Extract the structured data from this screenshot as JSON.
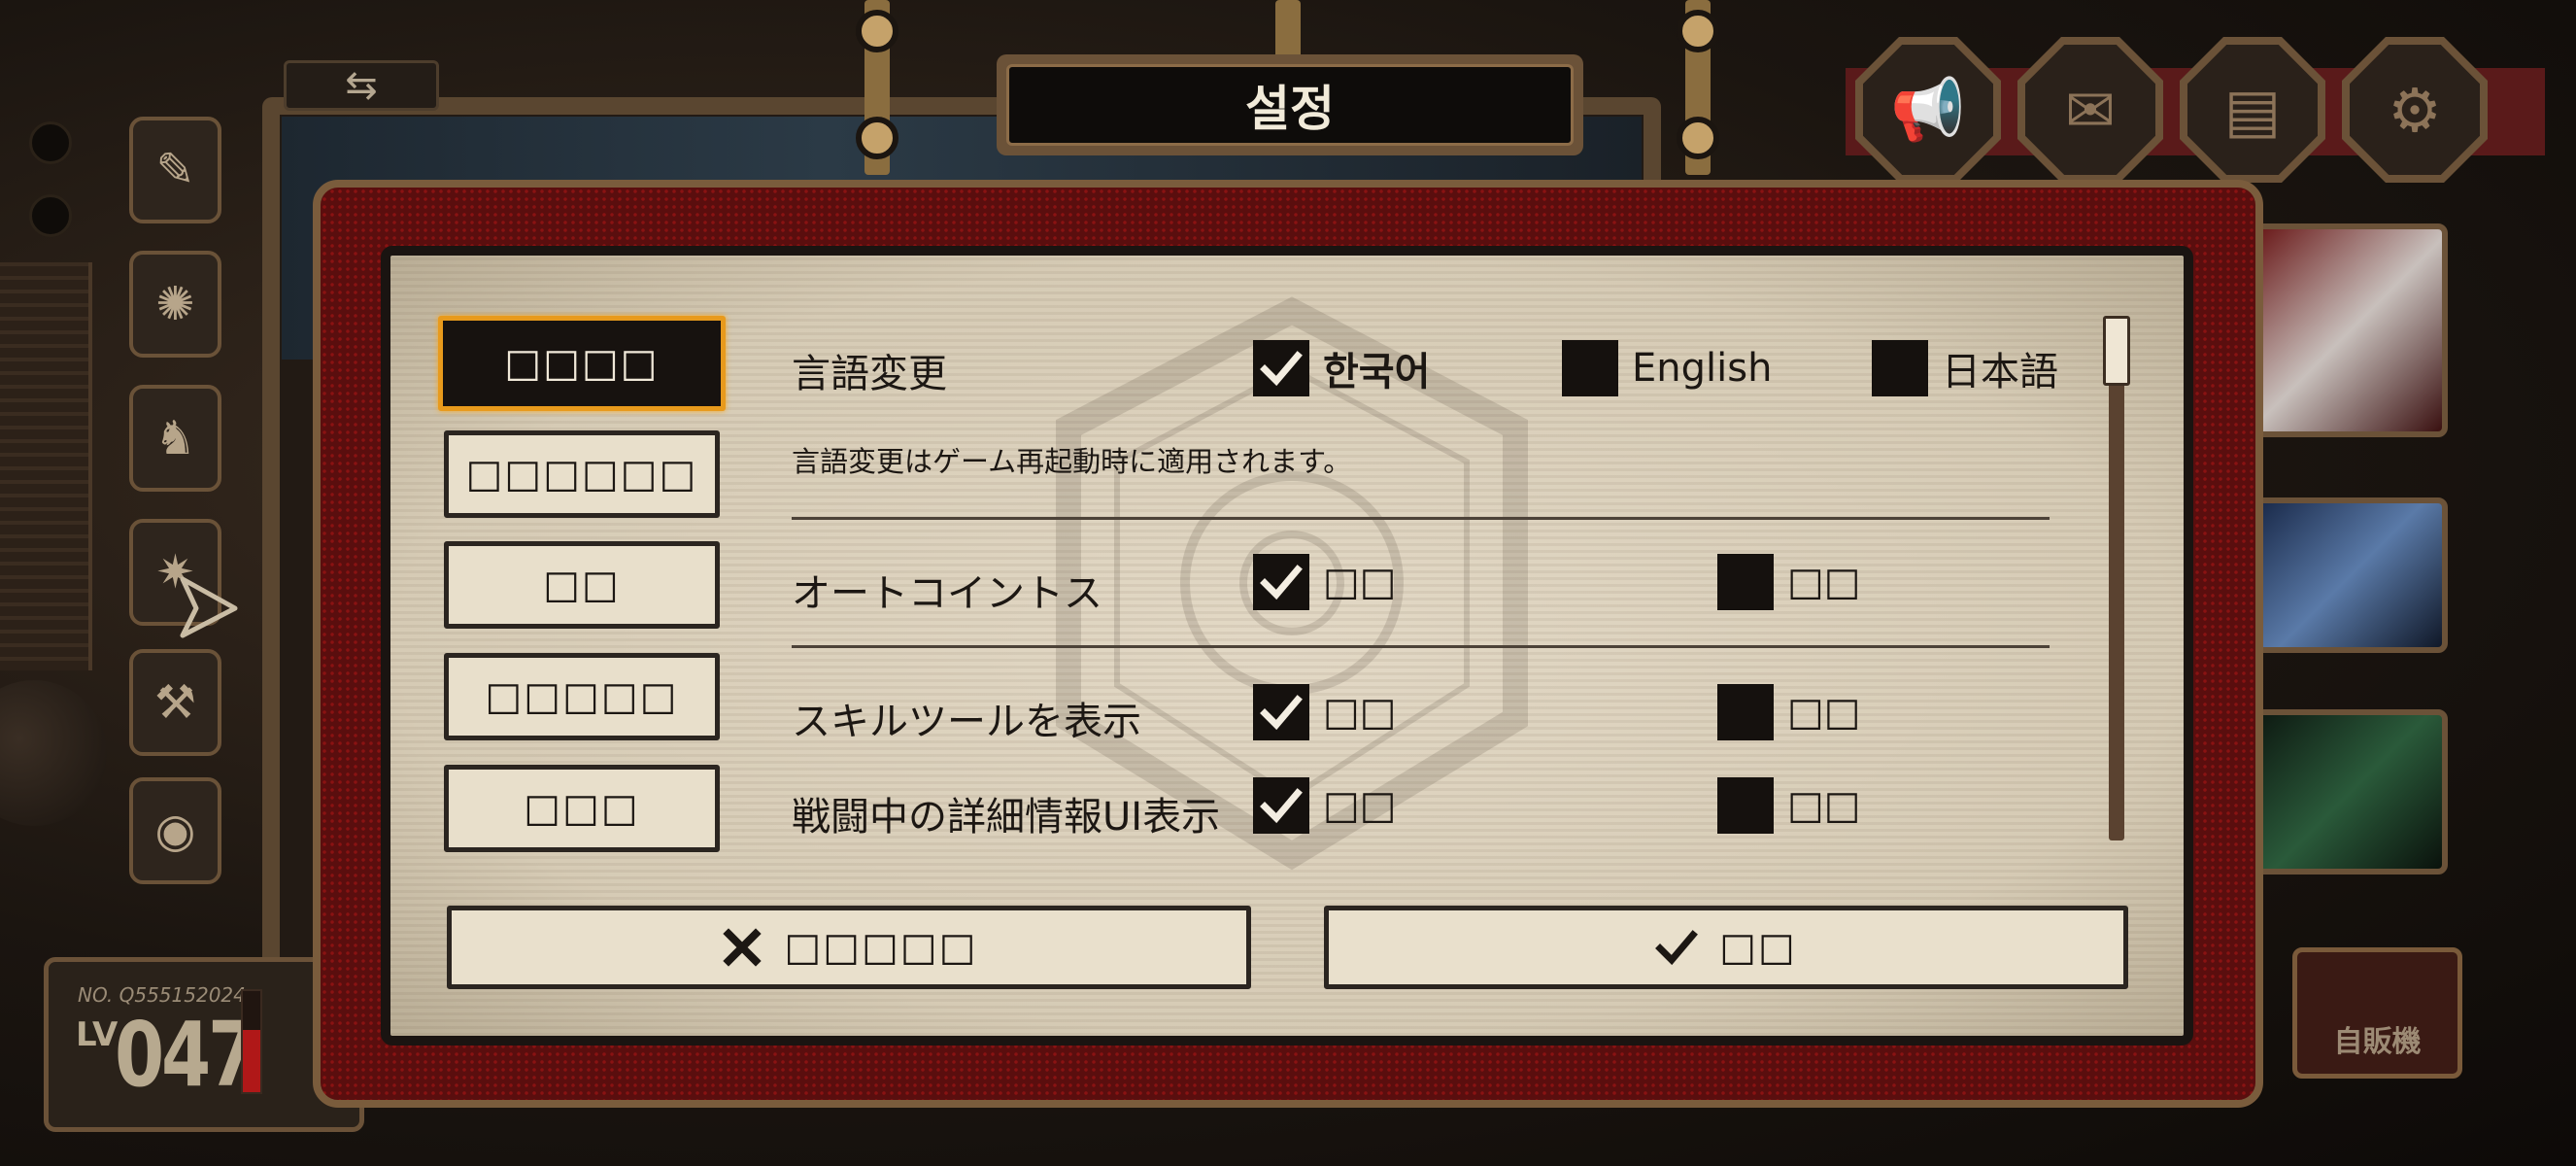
{
  "title": "설정",
  "tabs": [
    {
      "label": "□□□□",
      "active": true
    },
    {
      "label": "□□□□□□",
      "active": false
    },
    {
      "label": "□□",
      "active": false
    },
    {
      "label": "□□□□□",
      "active": false
    },
    {
      "label": "□□□",
      "active": false
    }
  ],
  "settings": {
    "language": {
      "label": "言語変更",
      "options": [
        {
          "label": "한국어",
          "checked": true
        },
        {
          "label": "English",
          "checked": false
        },
        {
          "label": "日本語",
          "checked": false
        }
      ],
      "note": "言語変更はゲーム再起動時に適用されます。"
    },
    "auto_toss": {
      "label": "オートコイントス",
      "on_label": "□□",
      "off_label": "□□",
      "selected": "on"
    },
    "skill_tool": {
      "label": "スキルツールを表示",
      "on_label": "□□",
      "off_label": "□□",
      "selected": "on"
    },
    "battle_detail": {
      "label": "戦闘中の詳細情報UI表示",
      "on_label": "□□",
      "off_label": "□□",
      "selected": "on"
    }
  },
  "buttons": {
    "cancel_label": "□□□□□",
    "confirm_label": "□□"
  },
  "player": {
    "number": "NO. Q555152024",
    "lv_label": "LV",
    "level": "047",
    "exp_fraction": 0.62
  },
  "vending_label": "自販機",
  "icons": {
    "swap": "swap-arrows-icon",
    "announcement": "megaphone-icon",
    "mail": "mail-icon",
    "storage": "chest-icon",
    "settings": "gear-icon"
  },
  "colors": {
    "tab_active_border": "#e89a1c",
    "dialog_red": "#5a0e0e",
    "paper": "#e3d9c6",
    "exp_bar": "#b01818"
  }
}
